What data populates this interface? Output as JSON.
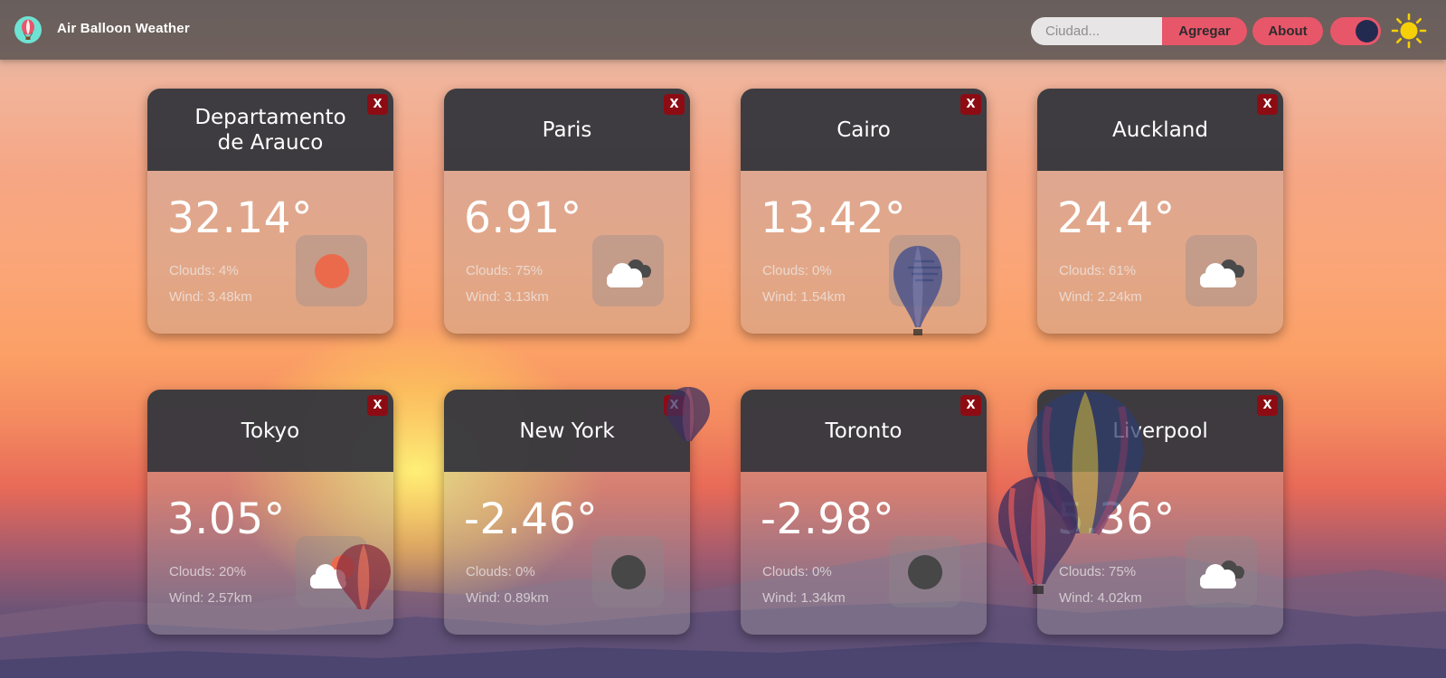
{
  "app": {
    "title": "Air Balloon Weather",
    "logo_icon": "balloon-icon"
  },
  "navbar": {
    "search_placeholder": "Ciudad...",
    "search_value": "",
    "add_label": "Agregar",
    "about_label": "About",
    "theme_toggle_icon": "theme-toggle",
    "theme_icon": "sun-icon"
  },
  "colors": {
    "accent": "#e8566a",
    "card_header": "#38383e",
    "close_button": "#8d0c14",
    "toggle_knob": "#232a4f",
    "sun": "#f5d008"
  },
  "cards": [
    {
      "city": "Departamento de Arauco",
      "temp": "32.14°",
      "clouds": "Clouds: 4%",
      "wind": "Wind: 3.48km",
      "close": "X",
      "icon": "sun-icon"
    },
    {
      "city": "Paris",
      "temp": "6.91°",
      "clouds": "Clouds: 75%",
      "wind": "Wind: 3.13km",
      "close": "X",
      "icon": "broken-clouds-icon"
    },
    {
      "city": "Cairo",
      "temp": "13.42°",
      "clouds": "Clouds: 0%",
      "wind": "Wind: 1.54km",
      "close": "X",
      "icon": "mist-icon"
    },
    {
      "city": "Auckland",
      "temp": "24.4°",
      "clouds": "Clouds: 61%",
      "wind": "Wind: 2.24km",
      "close": "X",
      "icon": "broken-clouds-icon"
    },
    {
      "city": "Tokyo",
      "temp": "3.05°",
      "clouds": "Clouds: 20%",
      "wind": "Wind: 2.57km",
      "close": "X",
      "icon": "few-clouds-icon"
    },
    {
      "city": "New York",
      "temp": "-2.46°",
      "clouds": "Clouds: 0%",
      "wind": "Wind: 0.89km",
      "close": "X",
      "icon": "clear-night-icon"
    },
    {
      "city": "Toronto",
      "temp": "-2.98°",
      "clouds": "Clouds: 0%",
      "wind": "Wind: 1.34km",
      "close": "X",
      "icon": "clear-night-icon"
    },
    {
      "city": "Liverpool",
      "temp": "5.36°",
      "clouds": "Clouds: 75%",
      "wind": "Wind: 4.02km",
      "close": "X",
      "icon": "broken-clouds-icon"
    }
  ]
}
